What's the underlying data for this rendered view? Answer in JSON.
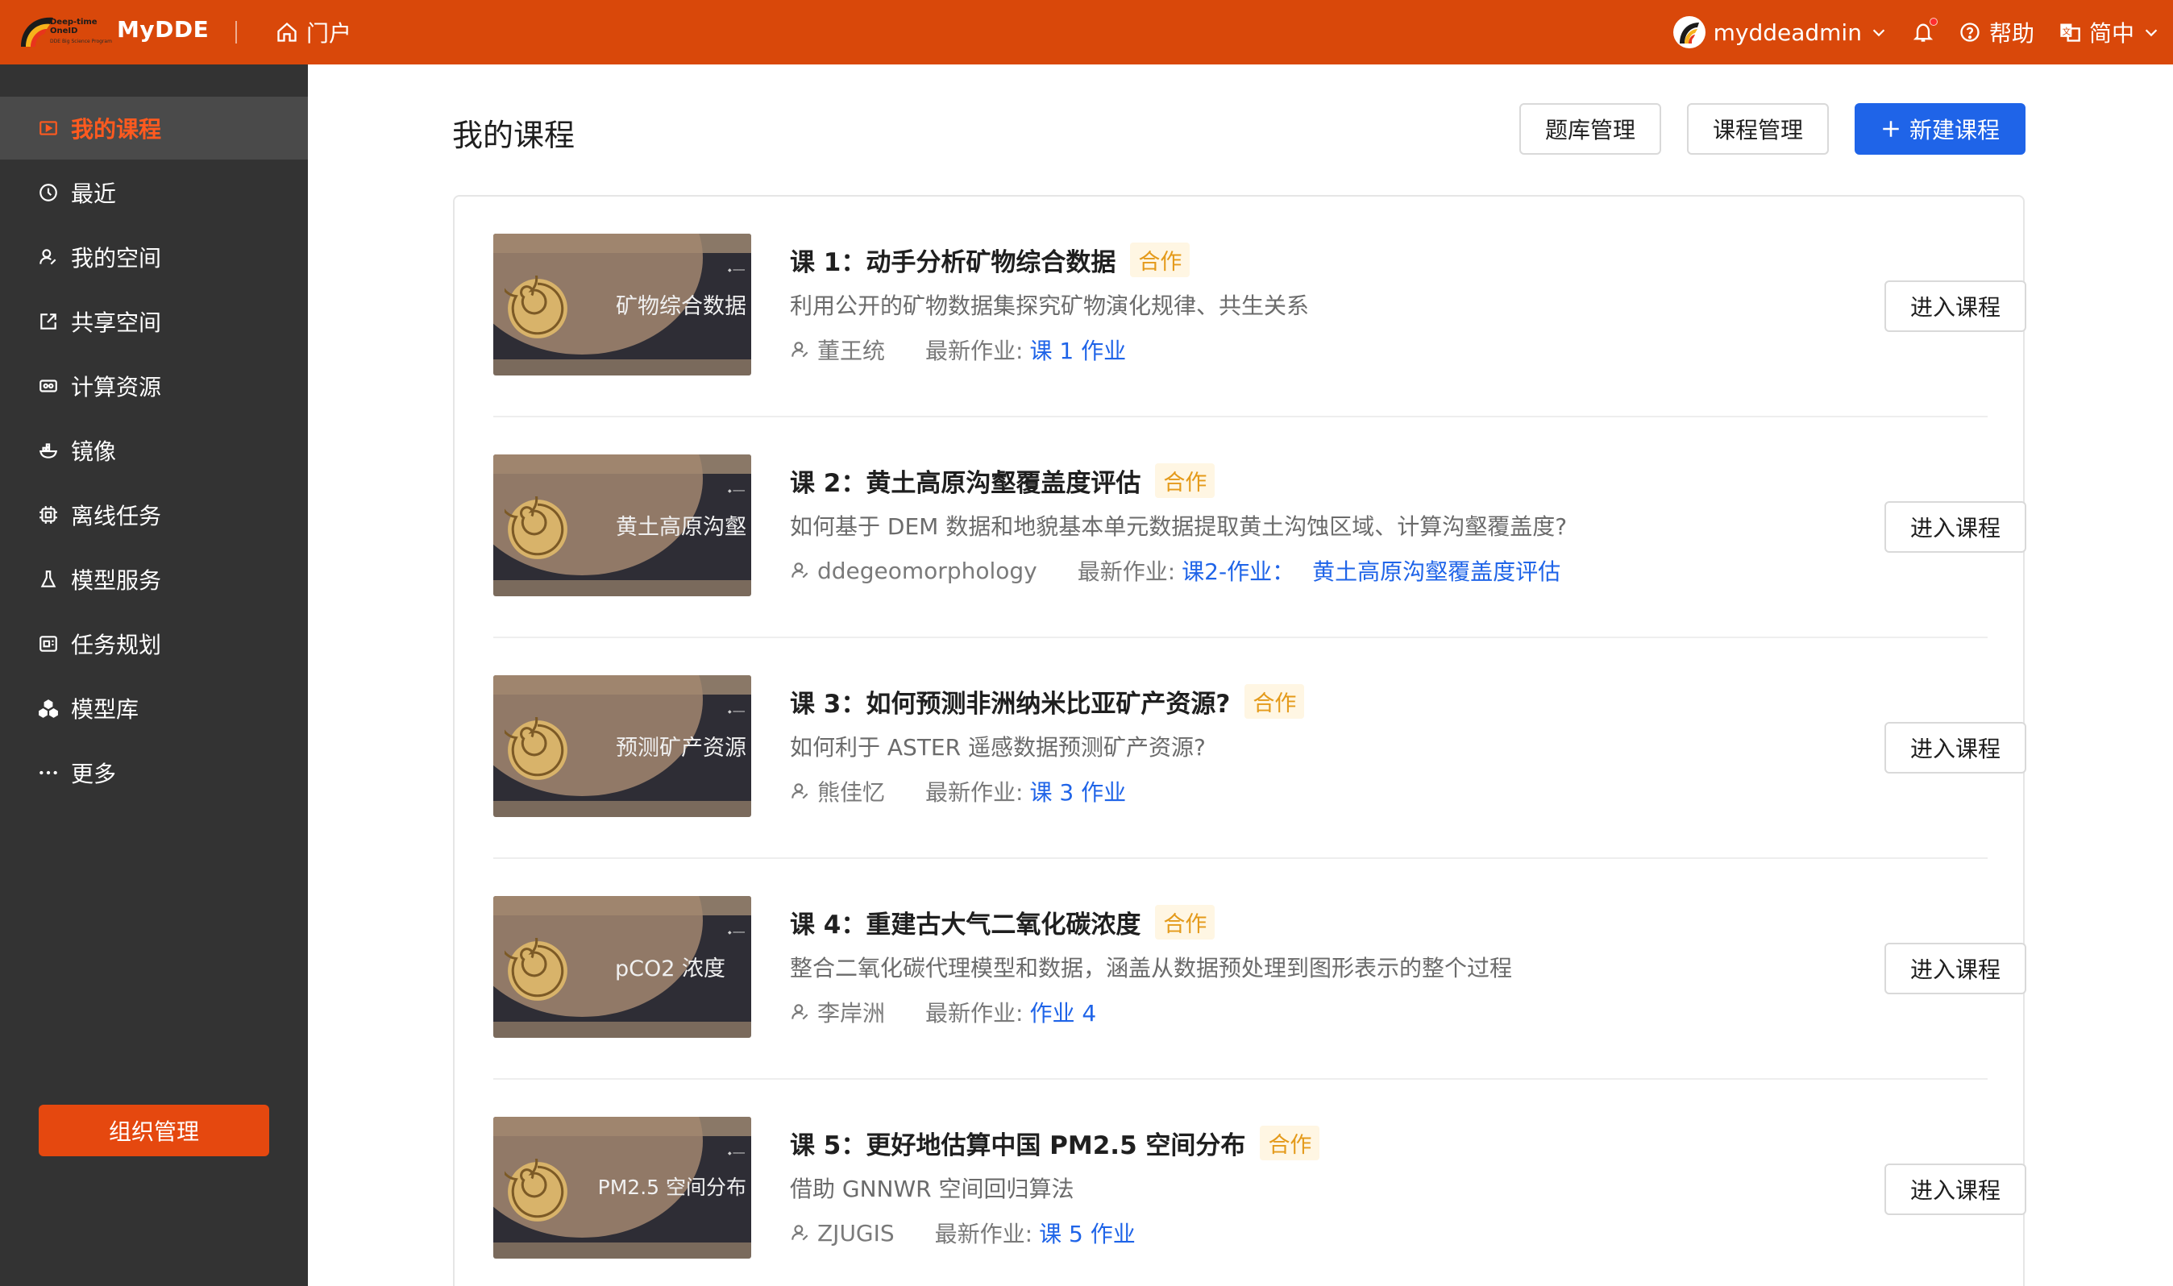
{
  "header": {
    "logo_line1": "Deep-time\nOneID",
    "logo_line2": "DDE Big Science Program",
    "brand": "MyDDE",
    "portal_label": "门户",
    "username": "myddeadmin",
    "help_label": "帮助",
    "language_label": "简中"
  },
  "sidebar": {
    "items": [
      {
        "label": "我的课程",
        "icon": "course-icon",
        "active": true
      },
      {
        "label": "最近",
        "icon": "clock-icon",
        "active": false
      },
      {
        "label": "我的空间",
        "icon": "user-icon",
        "active": false
      },
      {
        "label": "共享空间",
        "icon": "share-icon",
        "active": false
      },
      {
        "label": "计算资源",
        "icon": "compute-icon",
        "active": false
      },
      {
        "label": "镜像",
        "icon": "image-icon",
        "active": false
      },
      {
        "label": "离线任务",
        "icon": "task-icon",
        "active": false
      },
      {
        "label": "模型服务",
        "icon": "flask-icon",
        "active": false
      },
      {
        "label": "任务规划",
        "icon": "plan-icon",
        "active": false
      },
      {
        "label": "模型库",
        "icon": "cubes-icon",
        "active": false
      },
      {
        "label": "更多",
        "icon": "more-icon",
        "active": false
      }
    ],
    "org_button": "组织管理"
  },
  "main": {
    "title": "我的课程",
    "question_bank_button": "题库管理",
    "course_manage_button": "课程管理",
    "new_course_button": "新建课程",
    "enter_button": "进入课程",
    "latest_hw_label": "最新作业:",
    "courses": [
      {
        "thumb_text": "矿物综合数据",
        "title": "课 1：动手分析矿物综合数据",
        "tag": "合作",
        "desc": "利用公开的矿物数据集探究矿物演化规律、共生关系",
        "author": "董王统",
        "homework": [
          "课 1 作业"
        ]
      },
      {
        "thumb_text": "黄土高原沟壑",
        "title": "课 2：黄土高原沟壑覆盖度评估",
        "tag": "合作",
        "desc": "如何基于 DEM 数据和地貌基本单元数据提取黄土沟蚀区域、计算沟壑覆盖度?",
        "author": "ddegeomorphology",
        "homework": [
          "课2-作业：",
          "黄土高原沟壑覆盖度评估"
        ]
      },
      {
        "thumb_text": "预测矿产资源",
        "title": "课 3：如何预测非洲纳米比亚矿产资源?",
        "tag": "合作",
        "desc": "如何利于 ASTER 遥感数据预测矿产资源?",
        "author": "熊佳忆",
        "homework": [
          "课 3 作业"
        ]
      },
      {
        "thumb_text": "pCO2 浓度",
        "title": "课 4：重建古大气二氧化碳浓度",
        "tag": "合作",
        "desc": "整合二氧化碳代理模型和数据，涵盖从数据预处理到图形表示的整个过程",
        "author": "李岸洲",
        "homework": [
          "作业 4"
        ]
      },
      {
        "thumb_text": "PM2.5 空间分布",
        "title": "课 5：更好地估算中国 PM2.5 空间分布",
        "tag": "合作",
        "desc": "借助 GNNWR 空间回归算法",
        "author": "ZJUGIS",
        "homework": [
          "课 5 作业"
        ]
      }
    ]
  },
  "colors": {
    "header_bg": "#d9480a",
    "sidebar_bg": "#333333",
    "active_text": "#ff5a1f",
    "primary": "#1f64e8",
    "tag": "#e49a1a"
  }
}
